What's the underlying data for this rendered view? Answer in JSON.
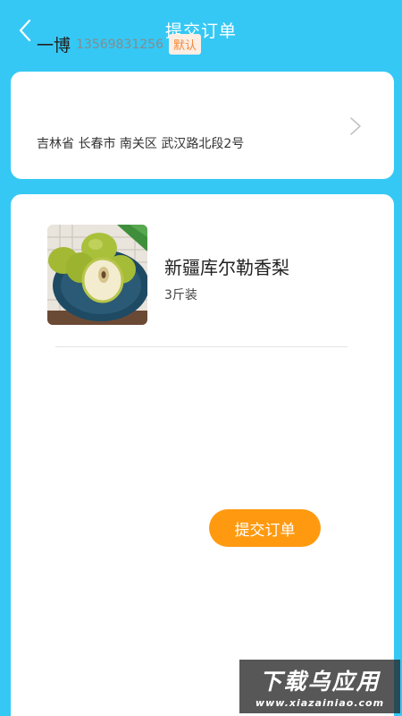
{
  "header": {
    "title": "提交订单",
    "back_icon": "chevron-left-icon"
  },
  "address": {
    "name": "一博",
    "phone": "13569831256",
    "badge": "默认",
    "detail": "吉林省 长春市 南关区 武汉路北段2号",
    "chevron_icon": "chevron-right-icon"
  },
  "goods": {
    "name": "新疆库尔勒香梨",
    "spec": "3斤装",
    "image": "pear-product-photo"
  },
  "actions": {
    "submit_label": "提交订单"
  },
  "watermark": {
    "main": "下载乌应用",
    "sub": "www.xiazainiao.com"
  },
  "colors": {
    "background": "#35C8F5",
    "accent": "#FF9A10",
    "badge_text": "#F0883C",
    "badge_bg": "#FDEEE3"
  }
}
